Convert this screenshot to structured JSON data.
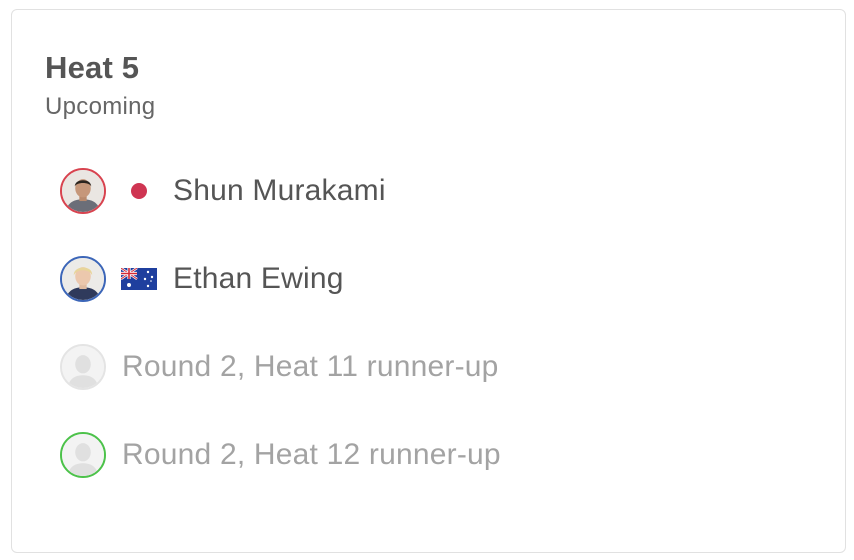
{
  "heat": {
    "title": "Heat 5",
    "status": "Upcoming"
  },
  "athletes": [
    {
      "name": "Shun Murakami",
      "ring_color": "#d8434f",
      "flag": "japan-flag-icon"
    },
    {
      "name": "Ethan Ewing",
      "ring_color": "#3c66b8",
      "flag": "australia-flag-icon"
    },
    {
      "name": "Round 2, Heat 11 runner-up",
      "ring_color": "#e4e4e4",
      "flag": null
    },
    {
      "name": "Round 2, Heat 12 runner-up",
      "ring_color": "#4cc24a",
      "flag": null
    }
  ]
}
